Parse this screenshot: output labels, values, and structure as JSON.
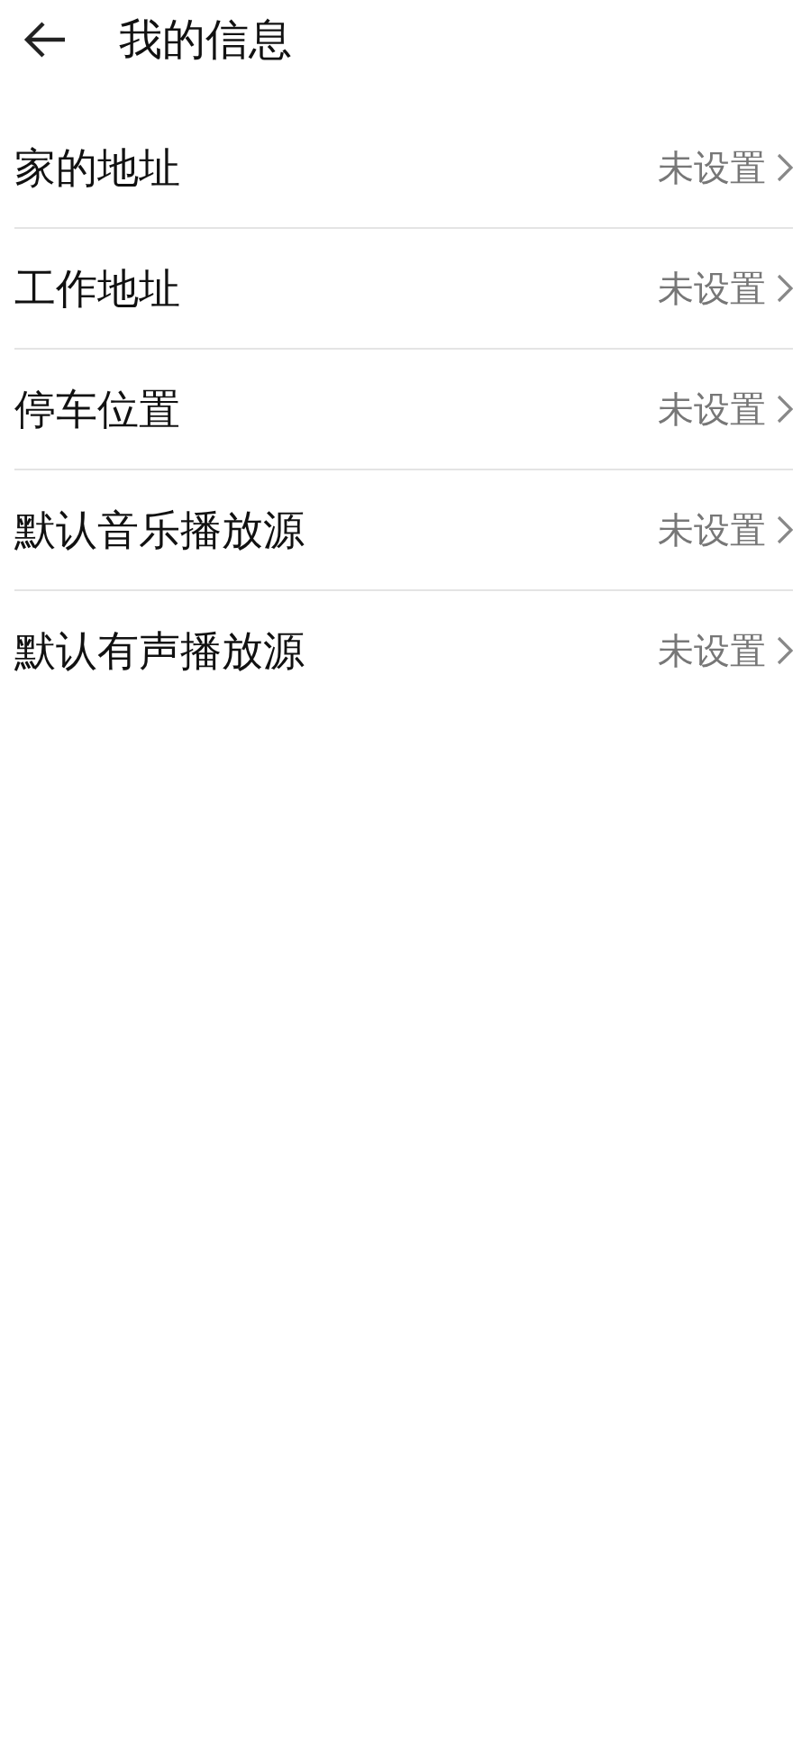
{
  "header": {
    "title": "我的信息"
  },
  "items": [
    {
      "label": "家的地址",
      "value": "未设置"
    },
    {
      "label": "工作地址",
      "value": "未设置"
    },
    {
      "label": "停车位置",
      "value": "未设置"
    },
    {
      "label": "默认音乐播放源",
      "value": "未设置"
    },
    {
      "label": "默认有声播放源",
      "value": "未设置"
    }
  ]
}
